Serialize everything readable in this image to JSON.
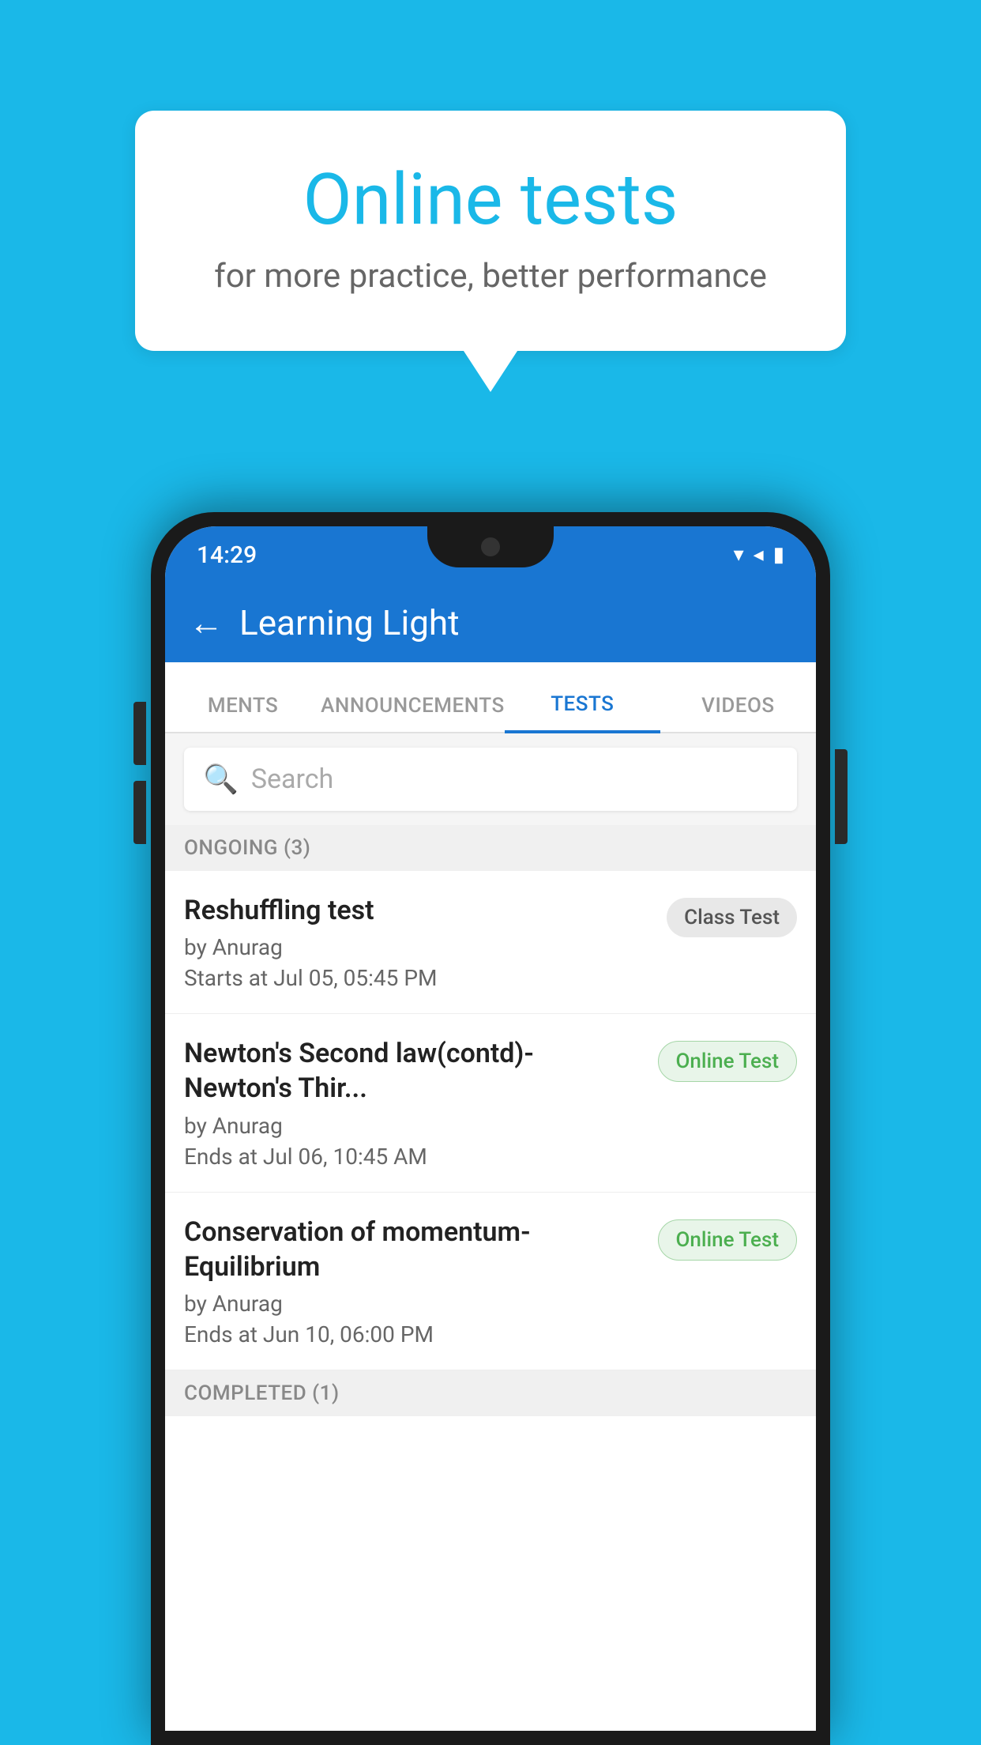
{
  "background_color": "#1ab8e8",
  "speech_bubble": {
    "title": "Online tests",
    "subtitle": "for more practice, better performance"
  },
  "status_bar": {
    "time": "14:29",
    "icons": [
      "▾",
      "◂",
      "▮"
    ]
  },
  "app_bar": {
    "title": "Learning Light",
    "back_label": "←"
  },
  "tabs": [
    {
      "label": "MENTS",
      "active": false
    },
    {
      "label": "ANNOUNCEMENTS",
      "active": false
    },
    {
      "label": "TESTS",
      "active": true
    },
    {
      "label": "VIDEOS",
      "active": false
    }
  ],
  "search": {
    "placeholder": "Search",
    "icon": "🔍"
  },
  "ongoing_section": {
    "label": "ONGOING (3)"
  },
  "test_items": [
    {
      "name": "Reshuffling test",
      "author": "by Anurag",
      "time_label": "Starts at",
      "time": "Jul 05, 05:45 PM",
      "badge": "Class Test",
      "badge_type": "class"
    },
    {
      "name": "Newton's Second law(contd)-Newton's Thir...",
      "author": "by Anurag",
      "time_label": "Ends at",
      "time": "Jul 06, 10:45 AM",
      "badge": "Online Test",
      "badge_type": "online"
    },
    {
      "name": "Conservation of momentum-Equilibrium",
      "author": "by Anurag",
      "time_label": "Ends at",
      "time": "Jun 10, 06:00 PM",
      "badge": "Online Test",
      "badge_type": "online"
    }
  ],
  "completed_section": {
    "label": "COMPLETED (1)"
  }
}
